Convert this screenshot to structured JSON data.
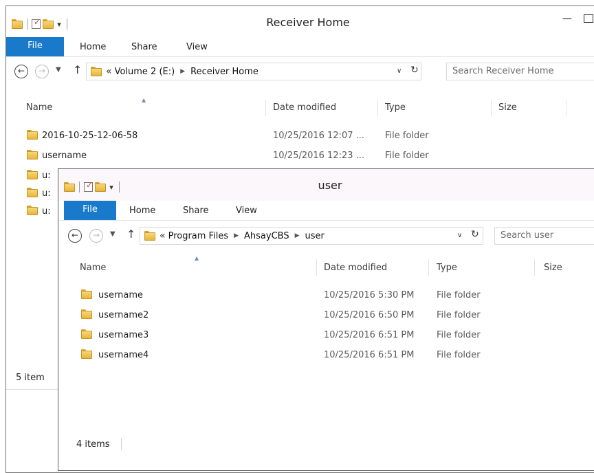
{
  "back_window": {
    "title": "Receiver Home",
    "tabs": [
      "File",
      "Home",
      "Share",
      "View"
    ],
    "address": {
      "prefix": "«",
      "crumbs": [
        "Volume 2 (E:)",
        "Receiver Home"
      ]
    },
    "search_placeholder": "Search Receiver Home",
    "columns": [
      "Name",
      "Date modified",
      "Type",
      "Size"
    ],
    "rows": [
      {
        "name": "2016-10-25-12-06-58",
        "date": "10/25/2016 12:07 ...",
        "type": "File folder"
      },
      {
        "name": "username",
        "date": "10/25/2016 12:23 ...",
        "type": "File folder"
      },
      {
        "name": "u:",
        "date": "",
        "type": ""
      },
      {
        "name": "u:",
        "date": "",
        "type": ""
      },
      {
        "name": "u:",
        "date": "",
        "type": ""
      }
    ],
    "status": "5 item"
  },
  "front_window": {
    "title": "user",
    "tabs": [
      "File",
      "Home",
      "Share",
      "View"
    ],
    "address": {
      "prefix": "«",
      "crumbs": [
        "Program Files",
        "AhsayCBS",
        "user"
      ]
    },
    "search_placeholder": "Search user",
    "columns": [
      "Name",
      "Date modified",
      "Type",
      "Size"
    ],
    "rows": [
      {
        "name": "username",
        "date": "10/25/2016 5:30 PM",
        "type": "File folder"
      },
      {
        "name": "username2",
        "date": "10/25/2016 6:50 PM",
        "type": "File folder"
      },
      {
        "name": "username3",
        "date": "10/25/2016 6:51 PM",
        "type": "File folder"
      },
      {
        "name": "username4",
        "date": "10/25/2016 6:51 PM",
        "type": "File folder"
      }
    ],
    "status": "4 items"
  },
  "icons": {
    "folder": "folder-icon",
    "properties": "properties-icon",
    "back": "back-arrow-icon",
    "forward": "forward-arrow-icon",
    "up": "up-arrow-icon",
    "refresh": "refresh-icon",
    "dropdown": "chevron-down-icon",
    "minimize": "minimize-icon",
    "maximize": "maximize-icon"
  },
  "colors": {
    "accent": "#1979ca",
    "folder": "#e8b53c"
  }
}
